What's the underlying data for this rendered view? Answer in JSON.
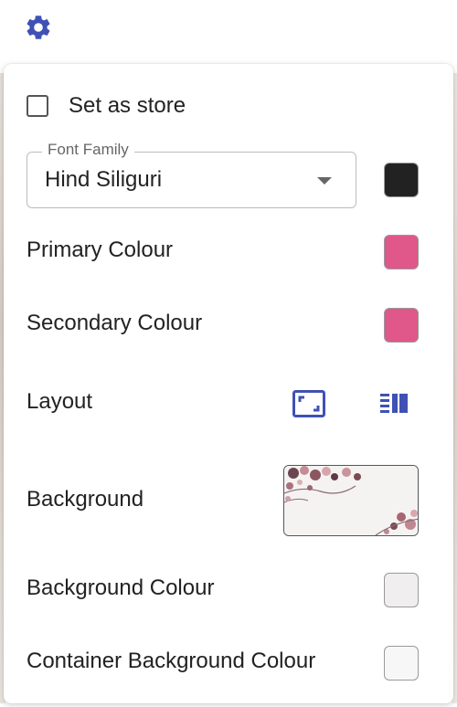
{
  "settings": {
    "set_as_store_label": "Set as store",
    "set_as_store_checked": false,
    "font_family": {
      "legend": "Font Family",
      "value": "Hind Siliguri",
      "color": "#222222"
    },
    "primary_colour": {
      "label": "Primary Colour",
      "color": "#e0578a"
    },
    "secondary_colour": {
      "label": "Secondary Colour",
      "color": "#e0578a"
    },
    "layout": {
      "label": "Layout",
      "options": [
        "fullscreen-icon",
        "list-layout-icon"
      ],
      "accent": "#3f51b5"
    },
    "background": {
      "label": "Background",
      "thumbnail_icon": "floral-image-thumbnail"
    },
    "background_colour": {
      "label": "Background Colour",
      "color": "#f0eeee"
    },
    "container_background_colour": {
      "label": "Container Background Colour",
      "color": "#f7f7f7"
    }
  }
}
